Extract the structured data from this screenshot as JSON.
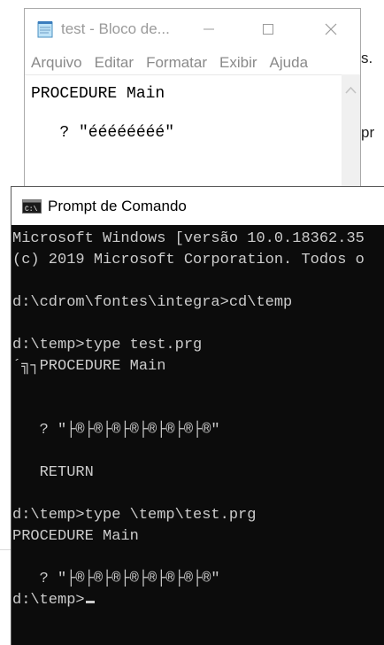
{
  "background": {
    "text_fragment_1": "s.",
    "text_fragment_2": "pr"
  },
  "notepad": {
    "icon": "notepad-icon",
    "title": "test - Bloco de...",
    "controls": {
      "minimize": "—",
      "maximize": "☐",
      "close": "✕"
    },
    "menu": [
      "Arquivo",
      "Editar",
      "Formatar",
      "Exibir",
      "Ajuda"
    ],
    "content": {
      "line1": "PROCEDURE Main",
      "line2": "   ? \"éééééééé\""
    }
  },
  "cmd": {
    "icon": "cmd-icon",
    "title": "Prompt de Comando",
    "lines": [
      "Microsoft Windows [versão 10.0.18362.35",
      "(c) 2019 Microsoft Corporation. Todos o",
      "",
      "d:\\cdrom\\fontes\\integra>cd\\temp",
      "",
      "d:\\temp>type test.prg",
      "´╗┐PROCEDURE Main",
      "",
      "",
      "   ? \"├®├®├®├®├®├®├®├®\"",
      "",
      "   RETURN",
      "",
      "d:\\temp>type \\temp\\test.prg",
      "PROCEDURE Main",
      "",
      "   ? \"├®├®├®├®├®├®├®├®\"",
      "d:\\temp>"
    ]
  },
  "colors": {
    "cmd_background": "#0c0c0c",
    "cmd_text": "#cccccc",
    "inactive_text": "#8a8a8a"
  }
}
